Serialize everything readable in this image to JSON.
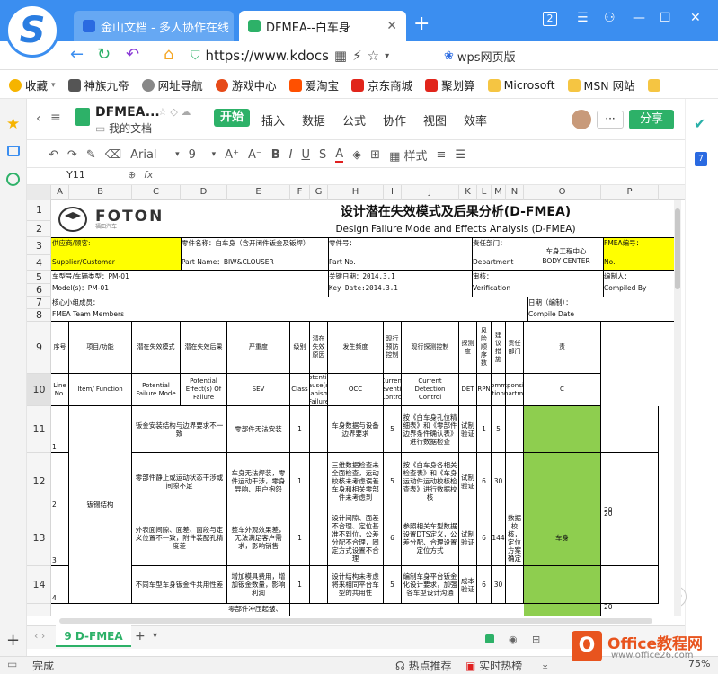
{
  "browser": {
    "tabs": [
      {
        "title": "金山文档 - 多人协作在线",
        "color": "#2a6ae1"
      },
      {
        "title": "DFMEA--白车身",
        "color": "#2db168"
      }
    ],
    "url": "https://www.kdocs",
    "search_text": "wps网页版",
    "tab_count": "2",
    "bookmarks": [
      {
        "label": "收藏",
        "color": "#f6b400"
      },
      {
        "label": "神族九帝",
        "color": "#555555"
      },
      {
        "label": "网址导航",
        "color": "#666666"
      },
      {
        "label": "游戏中心",
        "color": "#e64a19"
      },
      {
        "label": "爱淘宝",
        "color": "#ff5000"
      },
      {
        "label": "京东商城",
        "color": "#e1251b"
      },
      {
        "label": "聚划算",
        "color": "#e1251b"
      },
      {
        "label": "Microsoft",
        "color": "#f5c542"
      },
      {
        "label": "MSN 网站",
        "color": "#f5c542"
      }
    ]
  },
  "doc": {
    "title": "DFMEA...",
    "location": "我的文档",
    "menus": [
      "开始",
      "插入",
      "数据",
      "公式",
      "协作",
      "视图",
      "效率"
    ],
    "share_label": "分享",
    "more_label": "···"
  },
  "toolbar": {
    "font": "Arial",
    "size": "9",
    "style_label": "样式"
  },
  "formula": {
    "cell": "Y11",
    "fx": "fx"
  },
  "columns": [
    "A",
    "B",
    "C",
    "D",
    "E",
    "F",
    "G",
    "H",
    "I",
    "J",
    "K",
    "L",
    "M",
    "N",
    "O",
    "P"
  ],
  "rows": [
    "1",
    "2",
    "3",
    "4",
    "5",
    "6",
    "7",
    "8",
    "9",
    "10",
    "11",
    "12",
    "13",
    "14",
    "15"
  ],
  "sheet": {
    "logo_text": "FOTON",
    "logo_sub": "福田汽车",
    "title_cn": "设计潜在失效模式及后果分析(D-FMEA)",
    "title_en": "Design Failure Mode and Effects Analysis (D-FMEA)",
    "supplier_cn": "供应商/顾客:",
    "supplier_en": "Supplier/Customer",
    "part_name_cn": "零件名称：白车身（含开闭件钣金及钣焊）",
    "part_name_en": "Part Name：BIW&CLOUSER",
    "part_no_cn": "零件号：",
    "part_no_en": "Part No.",
    "dept_cn": "责任部门：",
    "dept_en": "Department",
    "dept_value_cn": "车身工程中心",
    "dept_value_en": "BODY CENTER",
    "fmea_no_cn": "FMEA编号：",
    "fmea_no_en": "No.",
    "model_cn": "车型号/车辆类型：PM-01",
    "model_en": "Model(s)：PM-01",
    "keydate_cn": "关键日期：2014.3.1",
    "keydate_en": "Key Date:2014.3.1",
    "verify_cn": "审核：",
    "verify_en": "Verification",
    "compiled_cn": "编制人：",
    "compiled_en": "Compiled By",
    "team_cn": "核心小组成员：",
    "team_en": "FMEA Team Members",
    "compdate_cn": "日期（编制）：",
    "compdate_en": "Compile Date",
    "headers_cn": [
      "序号",
      "项目/功能",
      "潜在失效模式",
      "潜在失效后果",
      "严重度",
      "级别",
      "潜在失效原因",
      "发生频度",
      "现行预防控制",
      "现行探测控制",
      "探测度",
      "风险顺序数",
      "建议措施",
      "责任部门",
      "责"
    ],
    "headers_en": [
      "Line No.",
      "Item/ Function",
      "Potential Failure Mode",
      "Potential Effect(s) Of Failure",
      "SEV",
      "Class",
      "Potential Cause(s)/ Mechanism(s)of Failure",
      "OCC",
      "Current Prevention Control",
      "Current Detection Control",
      "DET",
      "RPN",
      "Recomment Action(s)",
      "Responsible Department",
      "C"
    ],
    "item": "钣锡结构",
    "data_rows": [
      {
        "no": "1",
        "mode": "钣金安装结构与边界要求不一致",
        "effect": "零部件无法安装",
        "sev": "1",
        "cause": "车身数据与设备边界要求",
        "occ": "5",
        "prev": "按《白车身孔位精细表》和《零部件边界条件确认表》进行数据检查",
        "det_ctl": "试制验证",
        "det": "1",
        "rpn": "5",
        "action": "",
        "dept": ""
      },
      {
        "no": "2",
        "mode": "零部件静止或运动状态干涉或间隙不足",
        "effect": "车身无法焊装，零件运动干涉，零身异响、用户抱怨",
        "sev": "1",
        "cause": "三维数据检查未全面检查，运动校核未考虑误差车身和相关零部件未考虑到",
        "occ": "5",
        "prev": "按《白车身各相关检查表》和《车身运动件运动校核检查表》进行数据校核",
        "det_ctl": "试制验证",
        "det": "6",
        "rpn": "30",
        "action": "",
        "dept": ""
      },
      {
        "no": "3",
        "mode": "外表面间隙、面差、面段与定义位置不一致，附件装配孔精度差",
        "effect": "整车外观效果差，无法满足客户需求，影响销售",
        "sev": "1",
        "cause": "设计间隙、面差不合理、定位基准不到位，公差分配不合理，固定方式设置不合理",
        "occ": "6",
        "prev": "参照相关车型数据设置DTS定义，公差分配、合理设置定位方式",
        "det_ctl": "试制验证",
        "det": "6",
        "rpn": "144",
        "action": "数据校核，定位方案确定",
        "dept": "车身"
      },
      {
        "no": "4",
        "mode": "不同车型车身钣金件共用性差",
        "effect": "增加模具费用，增加钣金数量，影响利润",
        "sev": "1",
        "cause": "设计结构未考虑将来相同平台车型的共用性",
        "occ": "5",
        "prev": "编制车身平台钣金化设计要求，加强各车型设计沟通",
        "det_ctl": "成本验证",
        "det": "6",
        "rpn": "30",
        "action": "",
        "dept": ""
      }
    ],
    "row16_partial": "零部件冲压起皱、",
    "edge_values": [
      "20",
      "20",
      "20"
    ]
  },
  "sheet_tab": "9 D-FMEA",
  "status": {
    "left": "完成",
    "hot": "热点推荐",
    "live": "实时热榜",
    "zoom": "75%"
  },
  "watermark": {
    "text": "Office教程网",
    "url": "www.office26.com"
  },
  "colors": {
    "brand_green": "#2db168",
    "browser_blue": "#3b8ef0",
    "highlight_yellow": "#ffff00",
    "dept_green": "#8ece4f"
  }
}
